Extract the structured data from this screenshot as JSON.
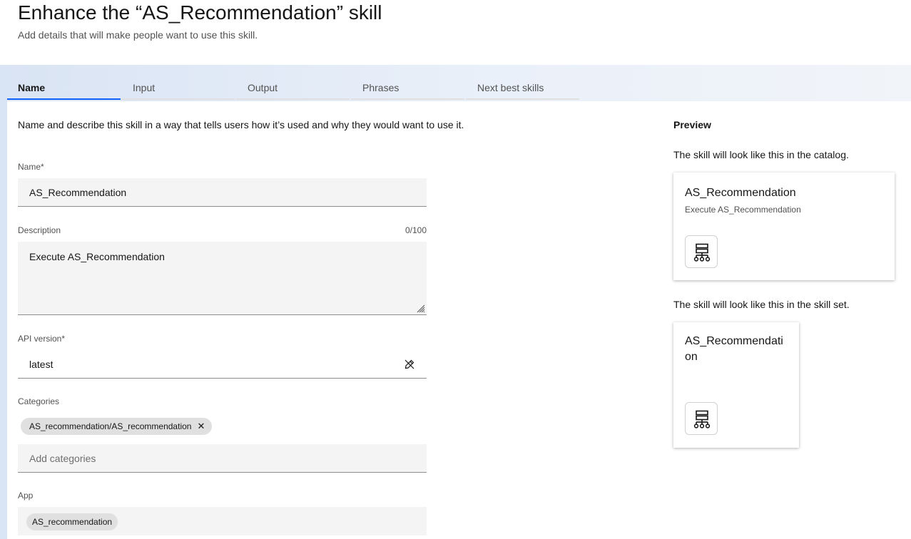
{
  "header": {
    "title": "Enhance the “AS_Recommendation” skill",
    "subtitle": "Add details that will make people want to use this skill."
  },
  "tabs": [
    {
      "label": "Name",
      "active": true
    },
    {
      "label": "Input",
      "active": false
    },
    {
      "label": "Output",
      "active": false
    },
    {
      "label": "Phrases",
      "active": false
    },
    {
      "label": "Next best skills",
      "active": false
    }
  ],
  "form": {
    "intro": "Name and describe this skill in a way that tells users how it’s used and why they would want to use it.",
    "name": {
      "label": "Name*",
      "value": "AS_Recommendation"
    },
    "description": {
      "label": "Description",
      "counter": "0/100",
      "value": "Execute AS_Recommendation"
    },
    "api_version": {
      "label": "API version*",
      "value": "latest"
    },
    "categories": {
      "label": "Categories",
      "tags": [
        "AS_recommendation/AS_recommendation"
      ],
      "tag_close": "✕",
      "placeholder": "Add categories"
    },
    "app": {
      "label": "App",
      "tags": [
        "AS_recommendation"
      ]
    }
  },
  "preview": {
    "title": "Preview",
    "catalog_text": "The skill will look like this in the catalog.",
    "catalog_card": {
      "title": "AS_Recommendation",
      "subtitle": "Execute AS_Recommendation",
      "icon": "skill-flow-icon"
    },
    "skillset_text": "The skill will look like this in the skill set.",
    "skillset_card": {
      "title": "AS_Recommendati on",
      "icon": "skill-flow-icon"
    }
  },
  "colors": {
    "accent": "#0f62fe",
    "field_bg": "#f4f4f4",
    "tag_bg": "#e0e0e0",
    "band_start": "#d9e4f4"
  }
}
